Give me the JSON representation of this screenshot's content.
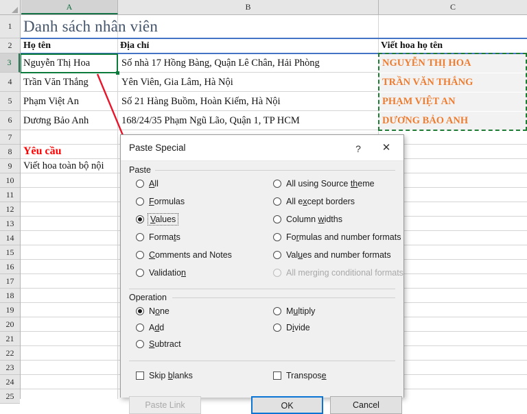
{
  "sheet": {
    "columns": [
      {
        "label": "A",
        "selected": true
      },
      {
        "label": "B",
        "selected": false
      },
      {
        "label": "C",
        "selected": false
      }
    ],
    "rows": [
      "1",
      "2",
      "3",
      "4",
      "5",
      "6",
      "7",
      "8",
      "9",
      "10",
      "11",
      "12",
      "13",
      "14",
      "15",
      "16",
      "17",
      "18",
      "19",
      "20",
      "21",
      "22",
      "23",
      "24",
      "25"
    ],
    "selected_row": "3",
    "title": "Danh sách nhân viên",
    "headers": {
      "a": "Họ tên",
      "b": "Địa chỉ",
      "c": "Viết hoa họ tên"
    },
    "records": [
      {
        "name": "Nguyễn Thị Hoa",
        "address": "Số nhà 17 Hồng Bàng, Quận Lê Chân, Hải Phòng",
        "upper": "NGUYỄN THỊ HOA"
      },
      {
        "name": "Trần Văn Thắng",
        "address": "Yên Viên, Gia Lâm, Hà Nội",
        "upper": "TRẦN VĂN THẮNG"
      },
      {
        "name": "Phạm Việt An",
        "address": "Số 21 Hàng Buồm, Hoàn Kiếm, Hà Nội",
        "upper": "PHẠM VIỆT AN"
      },
      {
        "name": "Dương Bảo Anh",
        "address": "168/24/35 Phạm Ngũ Lão, Quận 1, TP HCM",
        "upper": "DƯƠNG BẢO ANH"
      }
    ],
    "requirement_title": "Yêu cầu",
    "requirement_text": "Viết hoa toàn bộ nội",
    "colors": {
      "title": "#44546A",
      "upper_text": "#ED7D31",
      "requirement": "#FF0000",
      "selection_green": "#0b7a3b",
      "copy_marquee_green": "#1E7B34",
      "rule_blue": "#4472C4"
    }
  },
  "dialog": {
    "title": "Paste Special",
    "help_icon": "question-mark-icon",
    "close_icon": "close-x-icon",
    "paste": {
      "group_label": "Paste",
      "left_options": [
        {
          "label": "All",
          "underline": "A",
          "selected": false,
          "disabled": false
        },
        {
          "label": "Formulas",
          "underline": "F",
          "selected": false,
          "disabled": false
        },
        {
          "label": "Values",
          "underline": "V",
          "selected": true,
          "disabled": false,
          "focused": true
        },
        {
          "label": "Formats",
          "underline": "t",
          "selected": false,
          "disabled": false
        },
        {
          "label": "Comments and Notes",
          "underline": "C",
          "selected": false,
          "disabled": false
        },
        {
          "label": "Validation",
          "underline": "n",
          "selected": false,
          "disabled": false
        }
      ],
      "right_options": [
        {
          "label": "All using Source theme",
          "underline": "th",
          "selected": false,
          "disabled": false
        },
        {
          "label": "All except borders",
          "underline": "x",
          "selected": false,
          "disabled": false
        },
        {
          "label": "Column widths",
          "underline": "w",
          "selected": false,
          "disabled": false
        },
        {
          "label": "Formulas and number formats",
          "underline": "r",
          "selected": false,
          "disabled": false
        },
        {
          "label": "Values and number formats",
          "underline": "u",
          "selected": false,
          "disabled": false
        },
        {
          "label": "All merging conditional formats",
          "underline": "g",
          "selected": false,
          "disabled": true
        }
      ]
    },
    "operation": {
      "group_label": "Operation",
      "left_options": [
        {
          "label": "None",
          "underline": "o",
          "selected": true,
          "disabled": false
        },
        {
          "label": "Add",
          "underline": "d",
          "selected": false,
          "disabled": false
        },
        {
          "label": "Subtract",
          "underline": "S",
          "selected": false,
          "disabled": false
        }
      ],
      "right_options": [
        {
          "label": "Multiply",
          "underline": "u",
          "selected": false,
          "disabled": false
        },
        {
          "label": "Divide",
          "underline": "i",
          "selected": false,
          "disabled": false
        }
      ]
    },
    "checkboxes": [
      {
        "label": "Skip blanks",
        "underline": "b",
        "checked": false
      },
      {
        "label": "Transpose",
        "underline": "e",
        "checked": false
      }
    ],
    "buttons": {
      "paste_link": {
        "label": "Paste Link",
        "disabled": true,
        "default": false
      },
      "ok": {
        "label": "OK",
        "disabled": false,
        "default": true
      },
      "cancel": {
        "label": "Cancel",
        "disabled": false,
        "default": false
      }
    }
  },
  "annotation": {
    "arrow_color": "#E8142A",
    "arrow_from": "cell-a3",
    "arrow_to": "paste-values-radio"
  }
}
